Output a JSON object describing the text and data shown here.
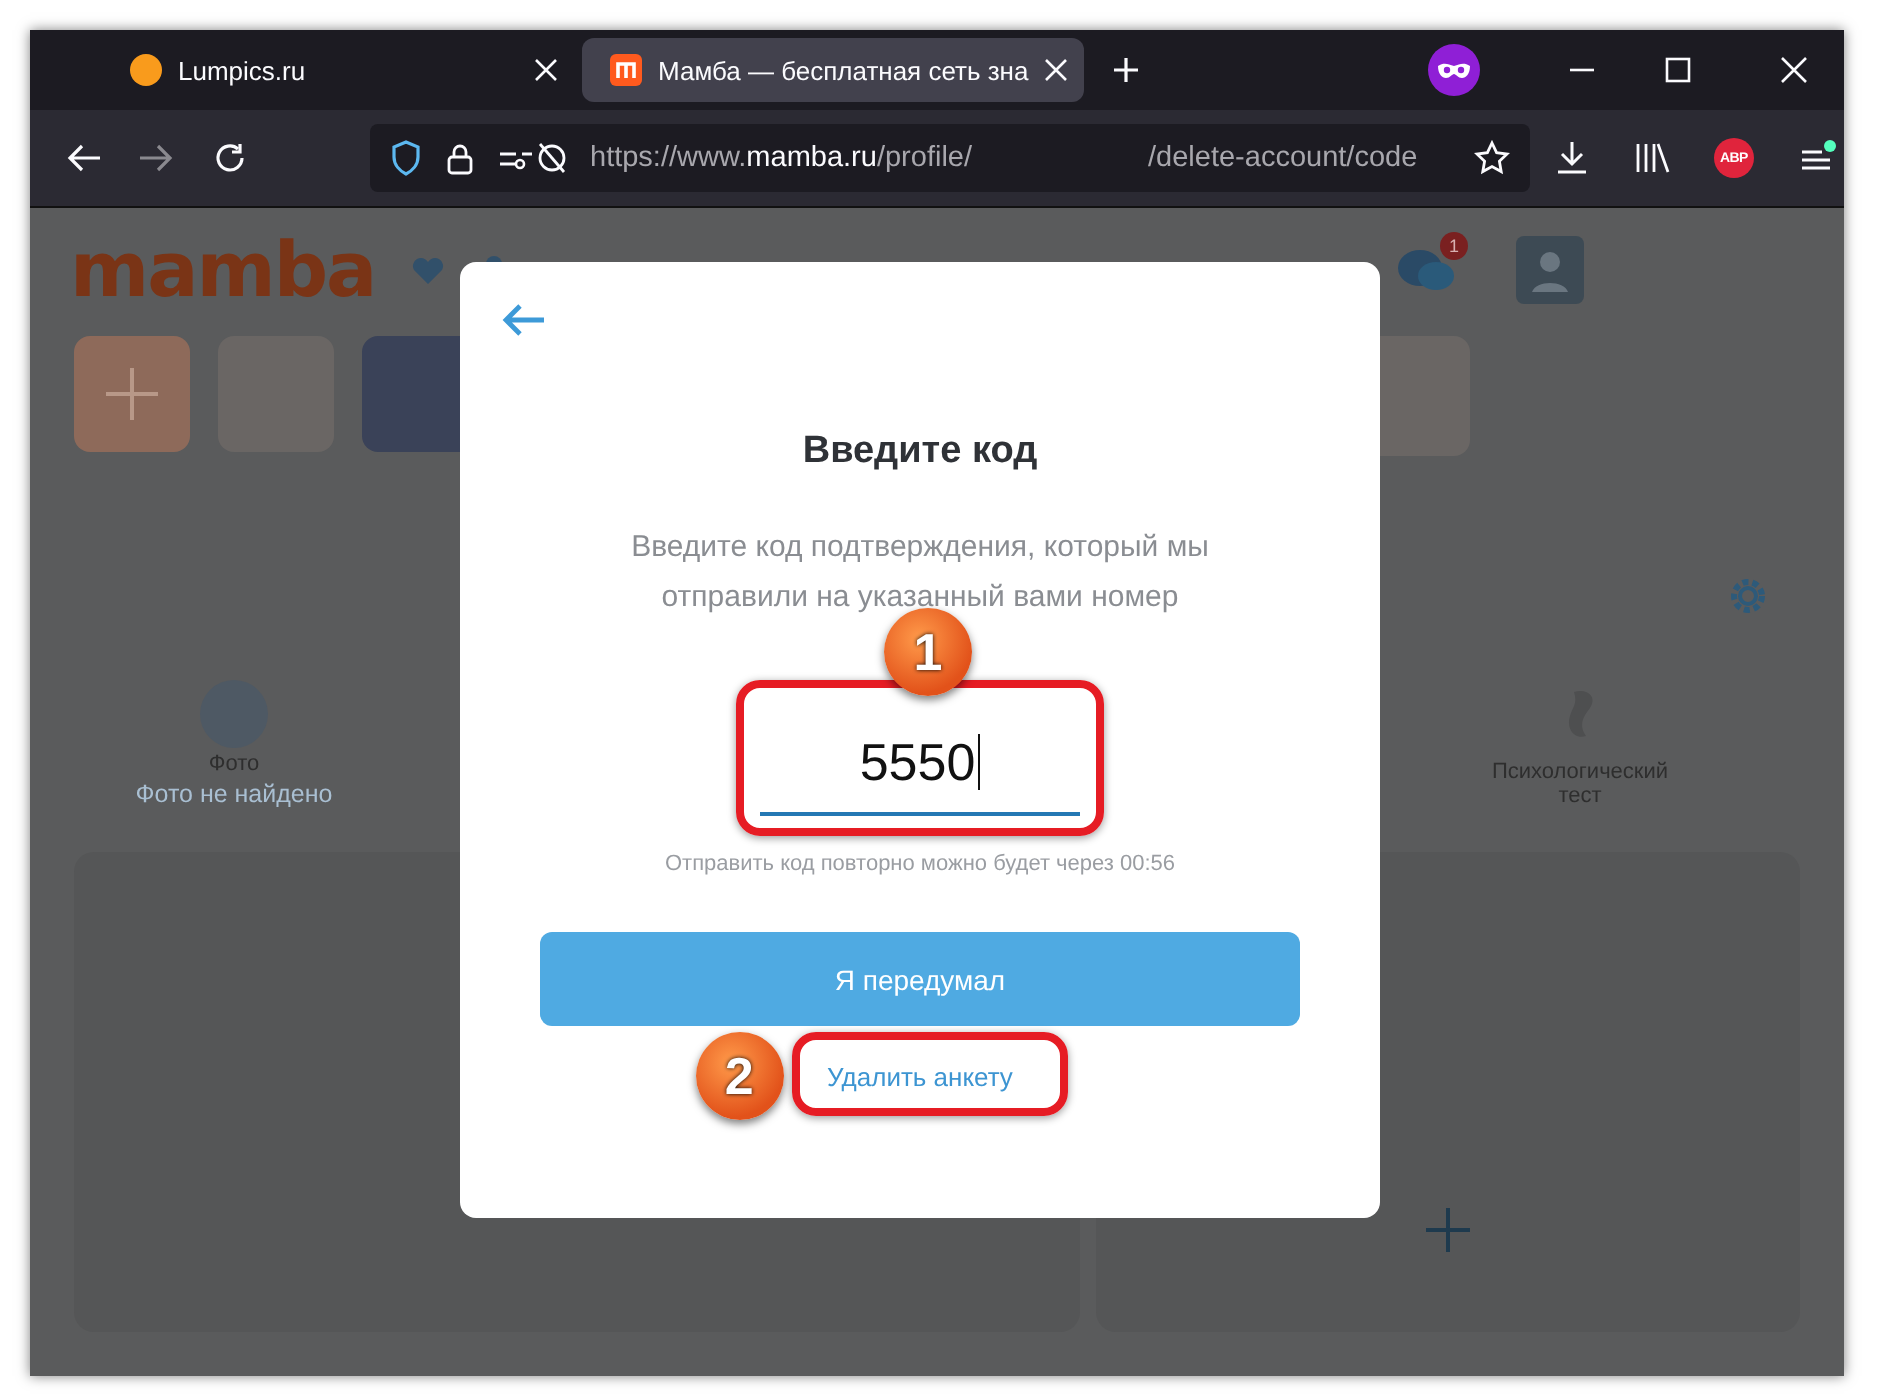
{
  "browser": {
    "tabs": [
      {
        "title": "Lumpics.ru",
        "selected": false
      },
      {
        "title": "Мамба — бесплатная сеть зна",
        "selected": true
      }
    ],
    "adblock_label": "ABP",
    "url": {
      "scheme": "https://www.",
      "host": "mamba.ru",
      "path": "/profile/",
      "tail": "/delete-account/code"
    }
  },
  "background_page": {
    "logo": "mamba",
    "chat_badge": "1",
    "photo_label": "Фото",
    "photo_status": "Фото не найдено",
    "test_label": "Психологический тест"
  },
  "modal": {
    "title": "Введите код",
    "description": "Введите код подтверждения, который мы отправили на указанный вами номер",
    "code_value": "5550",
    "resend_note": "Отправить код повторно можно будет через 00:56",
    "primary_button": "Я передумал",
    "delete_link": "Удалить анкету"
  },
  "callouts": [
    {
      "number": "1",
      "kind": "code"
    },
    {
      "number": "2",
      "kind": "link"
    }
  ]
}
